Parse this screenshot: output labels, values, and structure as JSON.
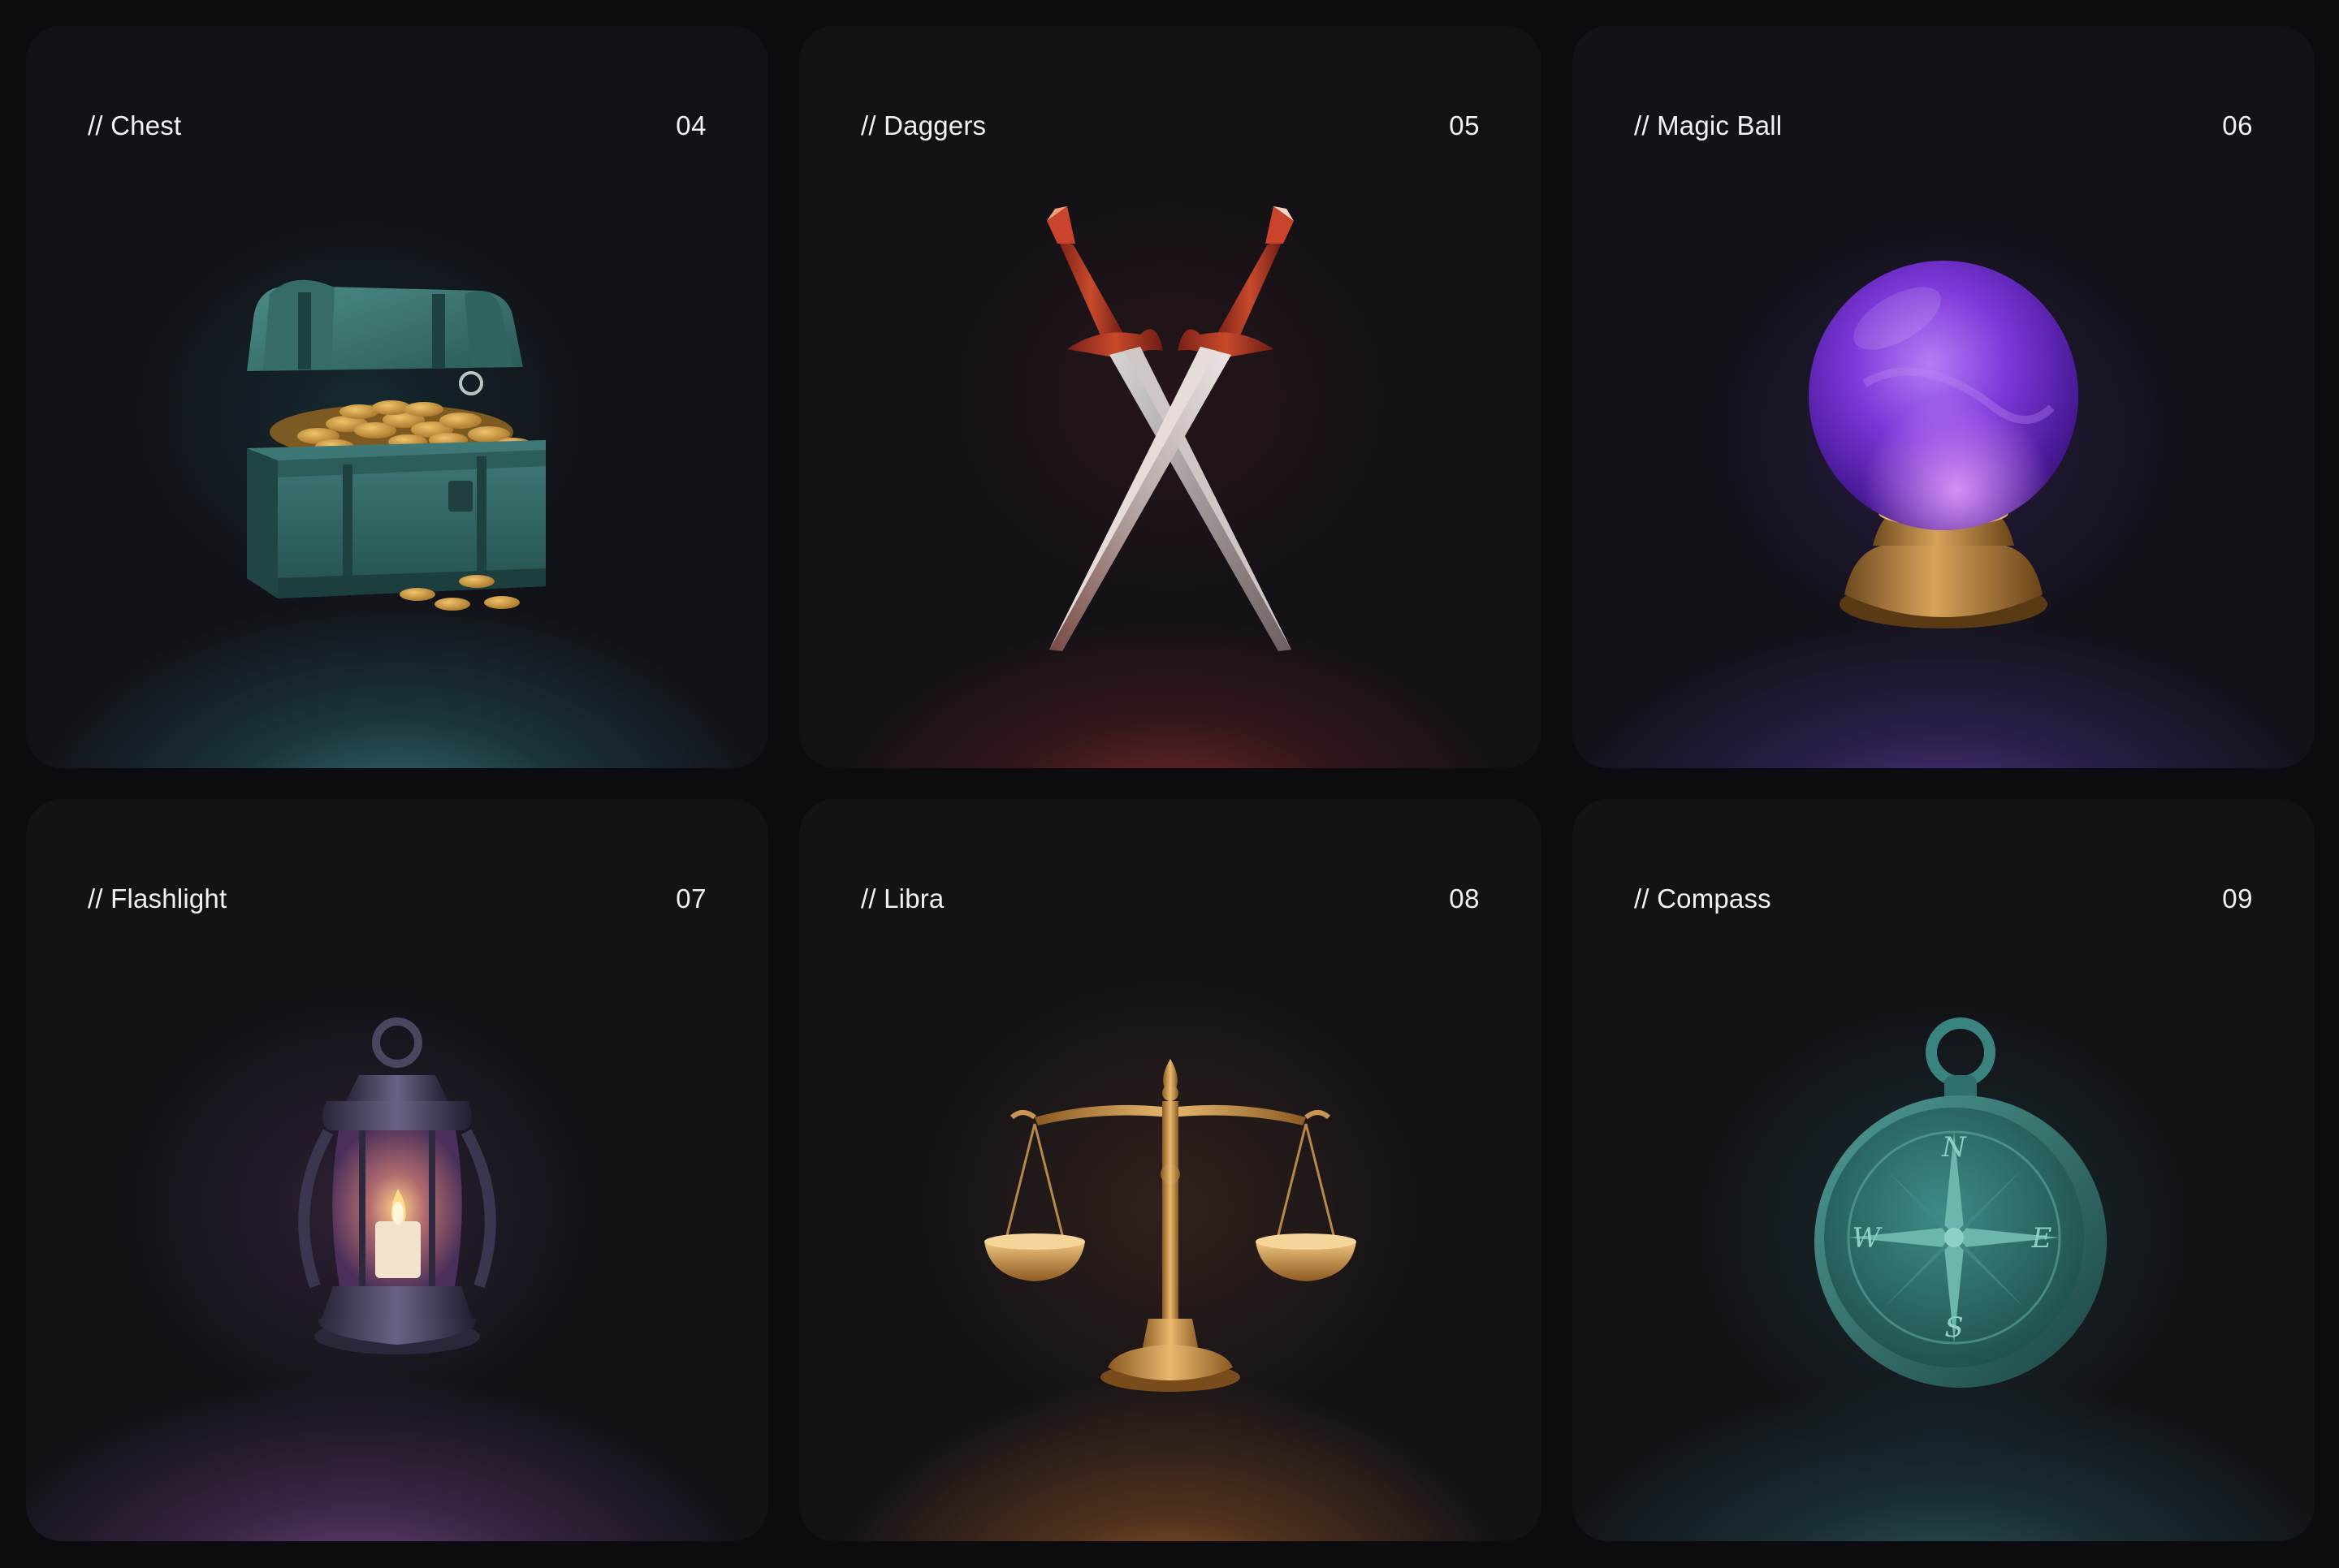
{
  "cards": [
    {
      "label": "// Chest",
      "number": "04",
      "icon": "treasure-chest-icon",
      "glow": "#3f8f95"
    },
    {
      "label": "// Daggers",
      "number": "05",
      "icon": "crossed-daggers-icon",
      "glow": "#a3373a"
    },
    {
      "label": "// Magic Ball",
      "number": "06",
      "icon": "crystal-ball-icon",
      "glow": "#6d4bbf"
    },
    {
      "label": "// Flashlight",
      "number": "07",
      "icon": "lantern-icon",
      "glow": "#8e5aa3"
    },
    {
      "label": "// Libra",
      "number": "08",
      "icon": "scales-icon",
      "glow": "#c97a32"
    },
    {
      "label": "// Compass",
      "number": "09",
      "icon": "compass-icon",
      "glow": "#3e8086"
    }
  ],
  "compass_letters": {
    "n": "N",
    "e": "E",
    "s": "S",
    "w": "W"
  }
}
